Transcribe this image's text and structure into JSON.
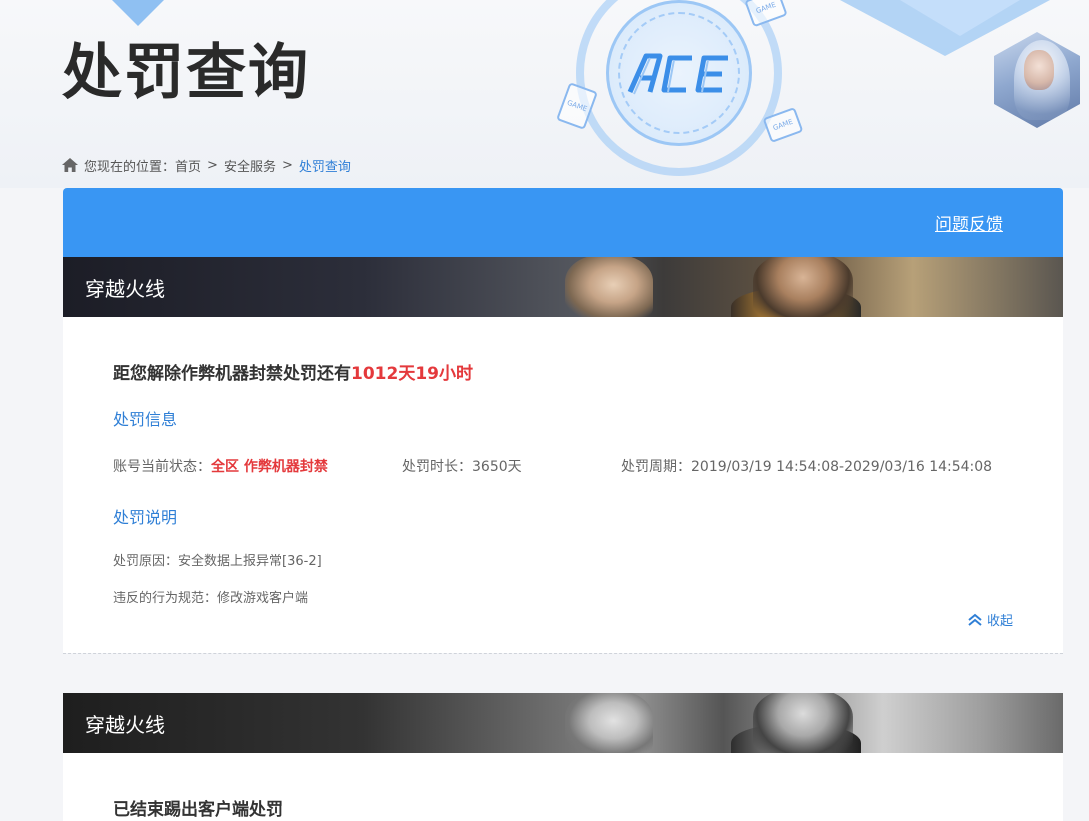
{
  "page": {
    "title": "处罚查询"
  },
  "breadcrumb": {
    "prefix": "您现在的位置：",
    "items": [
      "首页",
      "安全服务",
      "处罚查询"
    ],
    "separator": ">"
  },
  "toolbar": {
    "feedback_label": "问题反馈"
  },
  "header_art": {
    "logo_text": "ACE",
    "card_label": "GAME"
  },
  "records": [
    {
      "game": "穿越火线",
      "countdown_prefix": "距您解除作弊机器封禁处罚还有",
      "countdown_value": "1012天19小时",
      "penalty_info_title": "处罚信息",
      "status_label": "账号当前状态：",
      "status_value": "全区 作弊机器封禁",
      "duration_label": "处罚时长：",
      "duration_value": "3650天",
      "period_label": "处罚周期：",
      "period_value": "2019/03/19 14:54:08-2029/03/16 14:54:08",
      "explain_title": "处罚说明",
      "reason_label": "处罚原因：",
      "reason_value": "安全数据上报异常[36-2]",
      "violation_label": "违反的行为规范：",
      "violation_value": "修改游戏客户端",
      "collapse_label": "收起"
    },
    {
      "game": "穿越火线",
      "title": "已结束踢出客户端处罚"
    }
  ],
  "colors": {
    "accent": "#3996f3",
    "link": "#2f7fd6",
    "alert": "#e4393c"
  }
}
